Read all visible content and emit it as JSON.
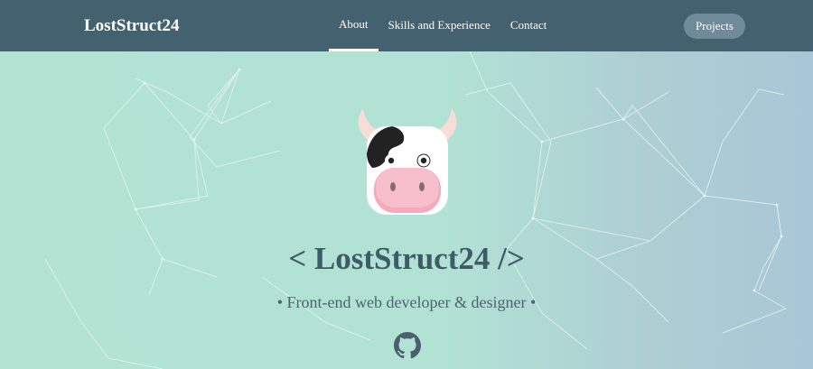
{
  "navbar": {
    "brand": "LostStruct24",
    "links": [
      {
        "label": "About",
        "active": true
      },
      {
        "label": "Skills and Experience",
        "active": false
      },
      {
        "label": "Contact",
        "active": false
      }
    ],
    "projects_button": "Projects"
  },
  "hero": {
    "title": "< LostStruct24 />",
    "subtitle": "• Front-end web developer & designer •",
    "logo_icon": "cow-icon",
    "social_icon": "github-icon"
  },
  "colors": {
    "navbar_bg": "#44616f",
    "hero_bg_start": "#b2e3d3",
    "hero_bg_end": "#a9c6d6",
    "title_text": "#3e5c68",
    "button_bg": "#6f8a98"
  }
}
